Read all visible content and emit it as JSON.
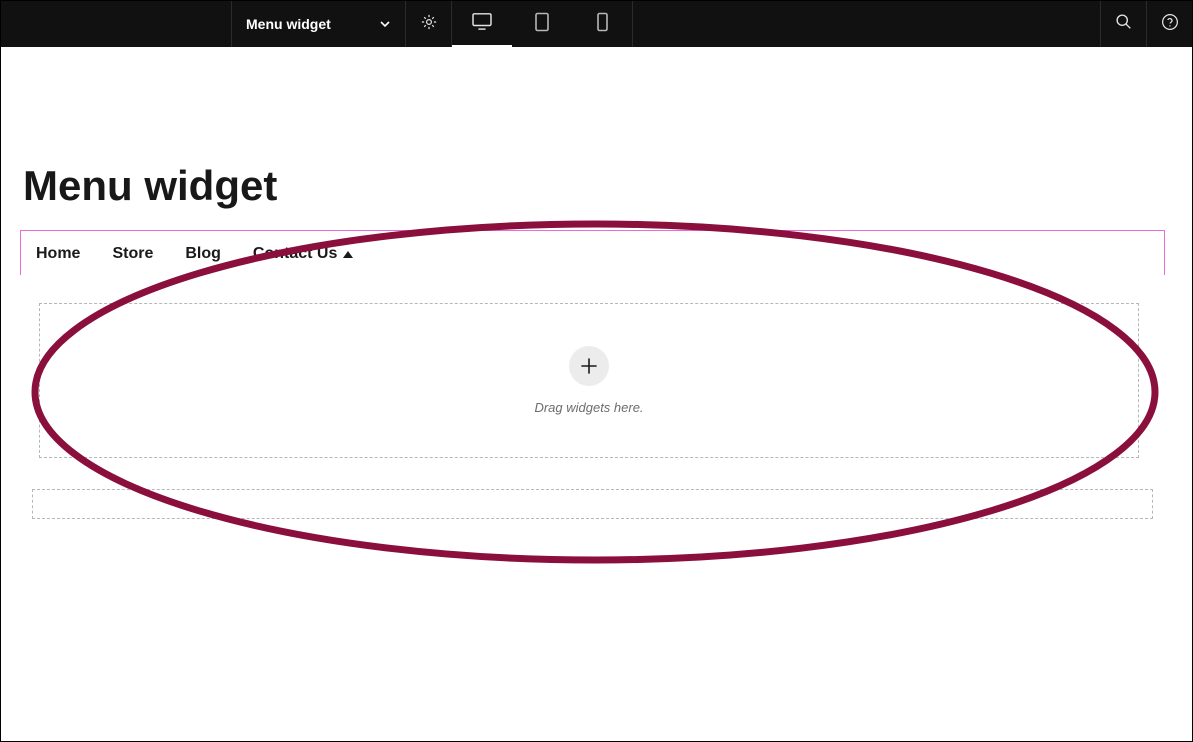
{
  "topbar": {
    "page_selector_label": "Menu widget"
  },
  "page": {
    "title": "Menu widget"
  },
  "menu": {
    "items": [
      {
        "label": "Home"
      },
      {
        "label": "Store"
      },
      {
        "label": "Blog"
      },
      {
        "label": "Contact Us",
        "has_caret": true
      }
    ]
  },
  "dropzone": {
    "hint": "Drag widgets here."
  }
}
